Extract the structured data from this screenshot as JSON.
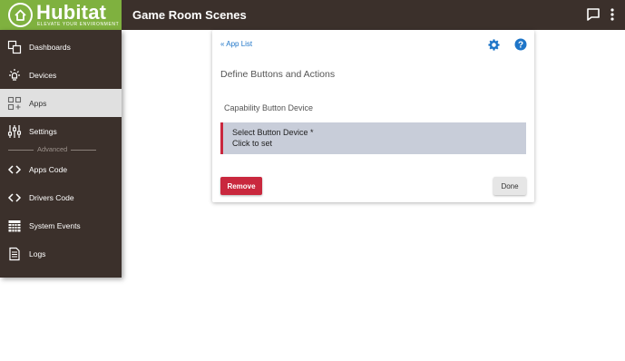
{
  "app": {
    "brand_name": "Hubitat",
    "brand_tagline": "ELEVATE YOUR ENVIRONMENT",
    "page_title": "Game Room Scenes",
    "brand_color": "#7fb13f",
    "header_color": "#3b302b"
  },
  "topbar": {
    "chat_icon": "chat-icon",
    "more_icon": "more-vertical-icon"
  },
  "sidebar": {
    "items": [
      {
        "label": "Dashboards",
        "icon": "dashboards-icon"
      },
      {
        "label": "Devices",
        "icon": "devices-icon"
      },
      {
        "label": "Apps",
        "icon": "apps-icon",
        "active": true
      },
      {
        "label": "Settings",
        "icon": "settings-sliders-icon"
      },
      {
        "label": "Apps Code",
        "icon": "code-icon"
      },
      {
        "label": "Drivers Code",
        "icon": "code-icon"
      },
      {
        "label": "System Events",
        "icon": "calendar-icon"
      },
      {
        "label": "Logs",
        "icon": "document-icon"
      }
    ],
    "divider_label": "Advanced"
  },
  "card": {
    "back_link": "« App List",
    "heading": "Define Buttons and Actions",
    "section_label": "Capability Button Device",
    "select": {
      "title": "Select Button Device *",
      "subtitle": "Click to set"
    },
    "remove_label": "Remove",
    "done_label": "Done",
    "accent_color": "#c9283e",
    "link_color": "#1e75c8"
  }
}
